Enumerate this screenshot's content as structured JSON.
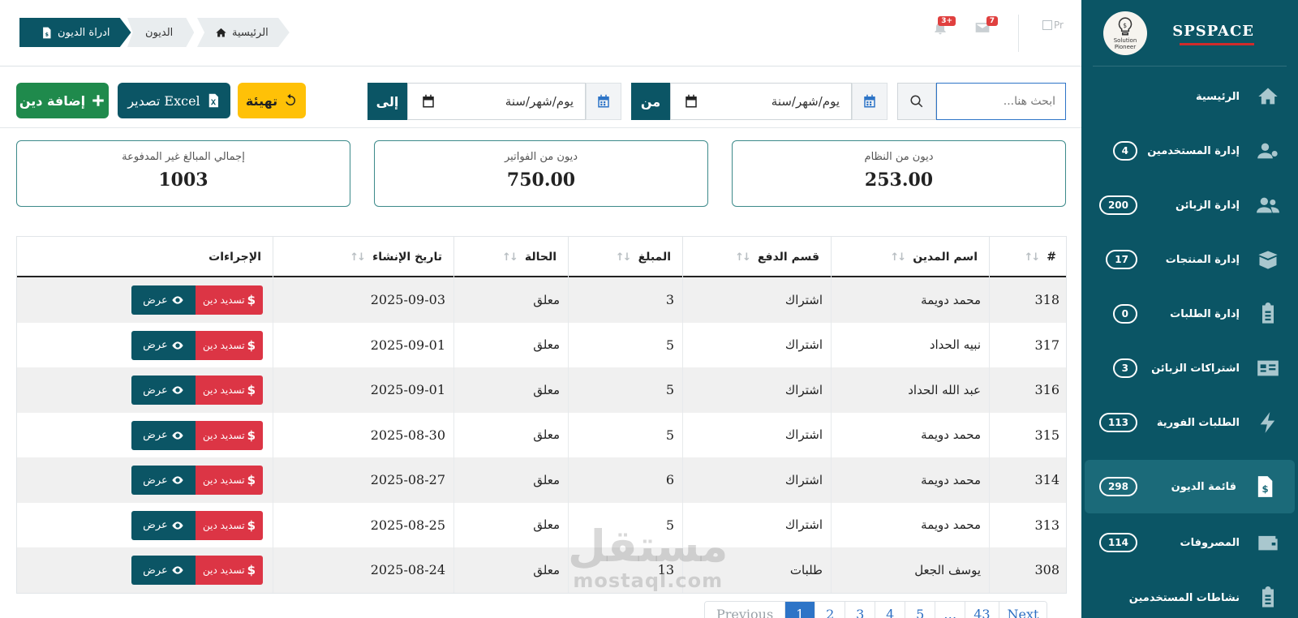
{
  "sidebar": {
    "brand": "SPSPACE",
    "logo_text": "Solution Pioneer",
    "items": [
      {
        "label": "الرئيسية",
        "badge": ""
      },
      {
        "label": "إدارة المستخدمين",
        "badge": "4"
      },
      {
        "label": "إدارة الزبائن",
        "badge": "200"
      },
      {
        "label": "إدارة المنتجات",
        "badge": "17"
      },
      {
        "label": "إدارة الطلبات",
        "badge": "0"
      },
      {
        "label": "اشتراكات الزبائن",
        "badge": "3"
      },
      {
        "label": "الطلبات الفورية",
        "badge": "113"
      },
      {
        "label": "قائمة الديون",
        "badge": "298"
      },
      {
        "label": "المصروفات",
        "badge": "114"
      },
      {
        "label": "نشاطات المستخدمين",
        "badge": ""
      }
    ]
  },
  "breadcrumb": {
    "home": "الرئيسية",
    "debts": "الديون",
    "current": "ادراة الديون"
  },
  "notifications": {
    "messages_count": "7",
    "alerts_count": "3+",
    "broken_image_alt": "Pr"
  },
  "toolbar": {
    "add_label": "إضافة دين",
    "export_label": "تصدير Excel",
    "reset_label": "تهيئة",
    "to_label": "إلى",
    "from_label": "من",
    "date_placeholder": "يوم/شهر/سنة",
    "search_placeholder": "ابحث هنا..."
  },
  "stats": [
    {
      "title": "ديون من النظام",
      "value": "253.00"
    },
    {
      "title": "ديون من الفواتير",
      "value": "750.00"
    },
    {
      "title": "إجمالي المبالغ غير المدفوعة",
      "value": "1003"
    }
  ],
  "table": {
    "headers": [
      "#",
      "اسم المدين",
      "قسم الدفع",
      "المبلغ",
      "الحالة",
      "تاريخ الإنشاء",
      "الإجراءات"
    ],
    "pay_label": "تسديد دين",
    "view_label": "عرض",
    "rows": [
      [
        "318",
        "محمد دويمة",
        "اشتراك",
        "3",
        "معلق",
        "2025-09-03"
      ],
      [
        "317",
        "نبيه الحداد",
        "اشتراك",
        "5",
        "معلق",
        "2025-09-01"
      ],
      [
        "316",
        "عبد الله الحداد",
        "اشتراك",
        "5",
        "معلق",
        "2025-09-01"
      ],
      [
        "315",
        "محمد دويمة",
        "اشتراك",
        "5",
        "معلق",
        "2025-08-30"
      ],
      [
        "314",
        "محمد دويمة",
        "اشتراك",
        "6",
        "معلق",
        "2025-08-27"
      ],
      [
        "313",
        "محمد دويمة",
        "اشتراك",
        "5",
        "معلق",
        "2025-08-25"
      ],
      [
        "308",
        "يوسف الجعل",
        "طلبات",
        "13",
        "معلق",
        "2025-08-24"
      ]
    ]
  },
  "pagination": {
    "previous": "Previous",
    "pages": [
      "1",
      "2",
      "3",
      "4",
      "5",
      "…",
      "43"
    ],
    "next": "Next"
  },
  "watermark": {
    "ar": "مستقل",
    "en": "mostaql.com"
  },
  "colors": {
    "primary": "#0b5565",
    "success": "#1f8a4c",
    "warning": "#ffc107",
    "danger": "#dc3545",
    "link": "#2d74c7"
  }
}
